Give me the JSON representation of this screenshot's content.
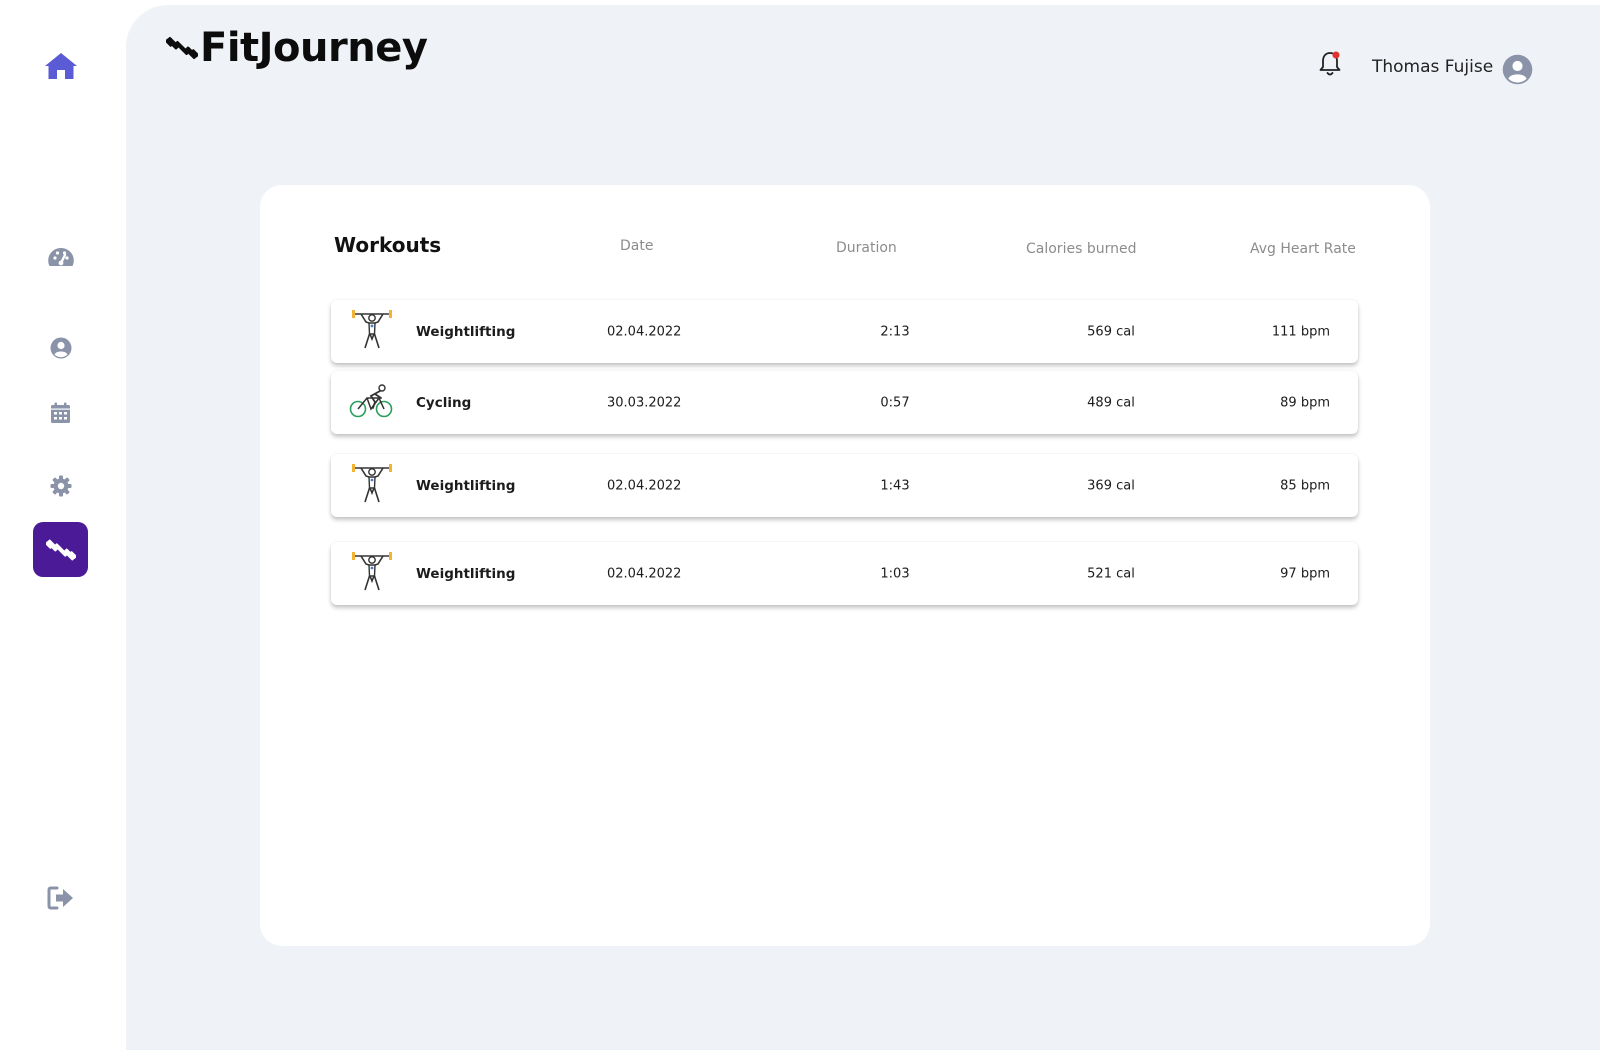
{
  "app": {
    "title": "FitJourney"
  },
  "header": {
    "user_name": "Thomas Fujise",
    "notification_icon": "bell-icon",
    "avatar_icon": "user-circle-icon"
  },
  "sidebar": {
    "items": [
      {
        "id": "home",
        "icon": "home-icon",
        "active": false
      },
      {
        "id": "dashboard",
        "icon": "gauge-icon",
        "active": false
      },
      {
        "id": "profile",
        "icon": "user-circle-icon",
        "active": false
      },
      {
        "id": "calendar",
        "icon": "calendar-icon",
        "active": false
      },
      {
        "id": "settings",
        "icon": "gear-icon",
        "active": false
      },
      {
        "id": "workouts",
        "icon": "dumbbell-icon",
        "active": true
      },
      {
        "id": "logout",
        "icon": "logout-icon",
        "active": false
      }
    ]
  },
  "workouts": {
    "title": "Workouts",
    "columns": [
      "Date",
      "Duration",
      "Calories burned",
      "Avg Heart Rate"
    ],
    "rows": [
      {
        "name": "Weightlifting",
        "icon": "weightlifter-icon",
        "date": "02.04.2022",
        "duration": "2:13",
        "calories": "569 cal",
        "heart_rate": "111 bpm"
      },
      {
        "name": "Cycling",
        "icon": "cyclist-icon",
        "date": "30.03.2022",
        "duration": "0:57",
        "calories": "489 cal",
        "heart_rate": "89 bpm"
      },
      {
        "name": "Weightlifting",
        "icon": "weightlifter-icon",
        "date": "02.04.2022",
        "duration": "1:43",
        "calories": "369 cal",
        "heart_rate": "85 bpm"
      },
      {
        "name": "Weightlifting",
        "icon": "weightlifter-icon",
        "date": "02.04.2022",
        "duration": "1:03",
        "calories": "521 cal",
        "heart_rate": "97 bpm"
      }
    ]
  },
  "colors": {
    "accent": "#4a1a97",
    "home_icon": "#5b5bd6",
    "nav_icon": "#8a93a8",
    "background": "#eff2f7",
    "notification_dot": "#e53030"
  }
}
